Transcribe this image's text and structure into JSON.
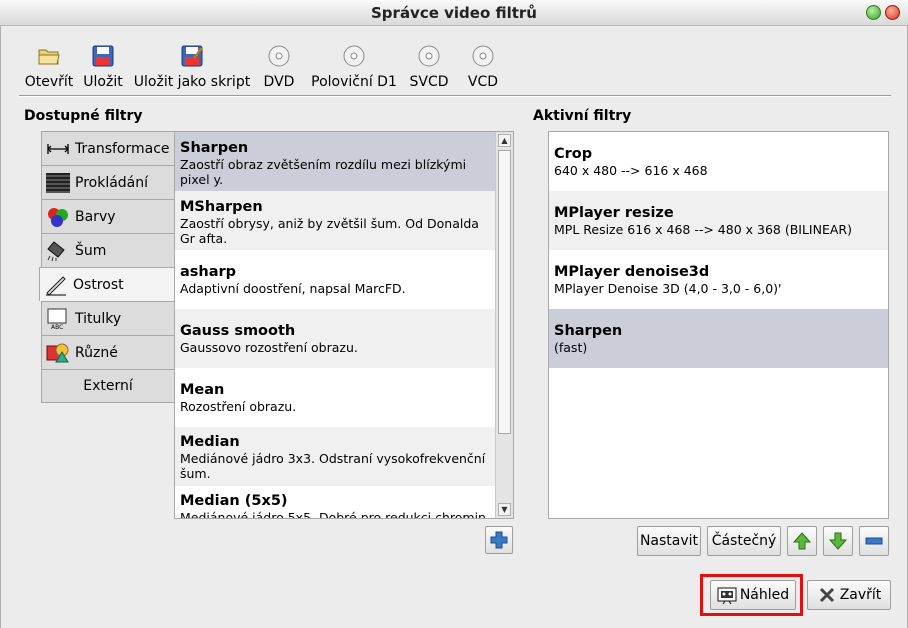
{
  "window": {
    "title": "Správce video filtrů"
  },
  "toolbar": [
    {
      "label": "Otevřít",
      "icon": "folder-open-icon"
    },
    {
      "label": "Uložit",
      "icon": "floppy-disk-icon"
    },
    {
      "label": "Uložit jako skript",
      "icon": "save-script-icon"
    },
    {
      "label": "DVD",
      "icon": "disc-icon"
    },
    {
      "label": "Poloviční D1",
      "icon": "disc-icon"
    },
    {
      "label": "SVCD",
      "icon": "disc-icon"
    },
    {
      "label": "VCD",
      "icon": "disc-icon"
    }
  ],
  "available": {
    "title": "Dostupné filtry",
    "categories": [
      {
        "label": "Transformace",
        "icon": "transform-icon"
      },
      {
        "label": "Prokládání",
        "icon": "interlace-icon"
      },
      {
        "label": "Barvy",
        "icon": "colors-icon"
      },
      {
        "label": "Šum",
        "icon": "noise-icon"
      },
      {
        "label": "Ostrost",
        "icon": "sharpness-icon",
        "active": true
      },
      {
        "label": "Titulky",
        "icon": "subtitles-icon"
      },
      {
        "label": "Různé",
        "icon": "misc-icon"
      },
      {
        "label": "Externí",
        "icon": ""
      }
    ],
    "filters": [
      {
        "name": "Sharpen",
        "desc": "Zaostří obraz zvětšením rozdílu mezi blízkými pixel y.",
        "selected": true
      },
      {
        "name": "MSharpen",
        "desc": "Zaostří obrysy, aniž by zvětšil šum. Od Donalda Gr afta."
      },
      {
        "name": "asharp",
        "desc": "Adaptivní doostření, napsal MarcFD."
      },
      {
        "name": "Gauss smooth",
        "desc": "Gaussovo rozostření obrazu."
      },
      {
        "name": "Mean",
        "desc": "Rozostření obrazu."
      },
      {
        "name": "Median",
        "desc": "Mediánové jádro 3x3. Odstraní vysokofrekvenční šum."
      },
      {
        "name": "Median (5x5)",
        "desc": "Mediánové jádro 5x5. Dobré pro redukci chromin"
      }
    ],
    "add_icon": "plus-icon"
  },
  "active": {
    "title": "Aktivní filtry",
    "filters": [
      {
        "name": "Crop",
        "desc": "640 x 480 --> 616 x 468"
      },
      {
        "name": "MPlayer resize",
        "desc": "MPL Resize 616 x 468 --> 480 x 368 (BILINEAR)"
      },
      {
        "name": "MPlayer denoise3d",
        "desc": "MPlayer Denoise 3D (4,0 - 3,0 - 6,0)'"
      },
      {
        "name": "Sharpen",
        "desc": "(fast)",
        "selected": true
      }
    ],
    "configure_label": "Nastavit",
    "partial_label": "Částečný",
    "up_icon": "arrow-up-icon",
    "down_icon": "arrow-down-icon",
    "remove_icon": "minus-icon"
  },
  "footer": {
    "preview_label": "Náhled",
    "close_label": "Zavřít"
  }
}
